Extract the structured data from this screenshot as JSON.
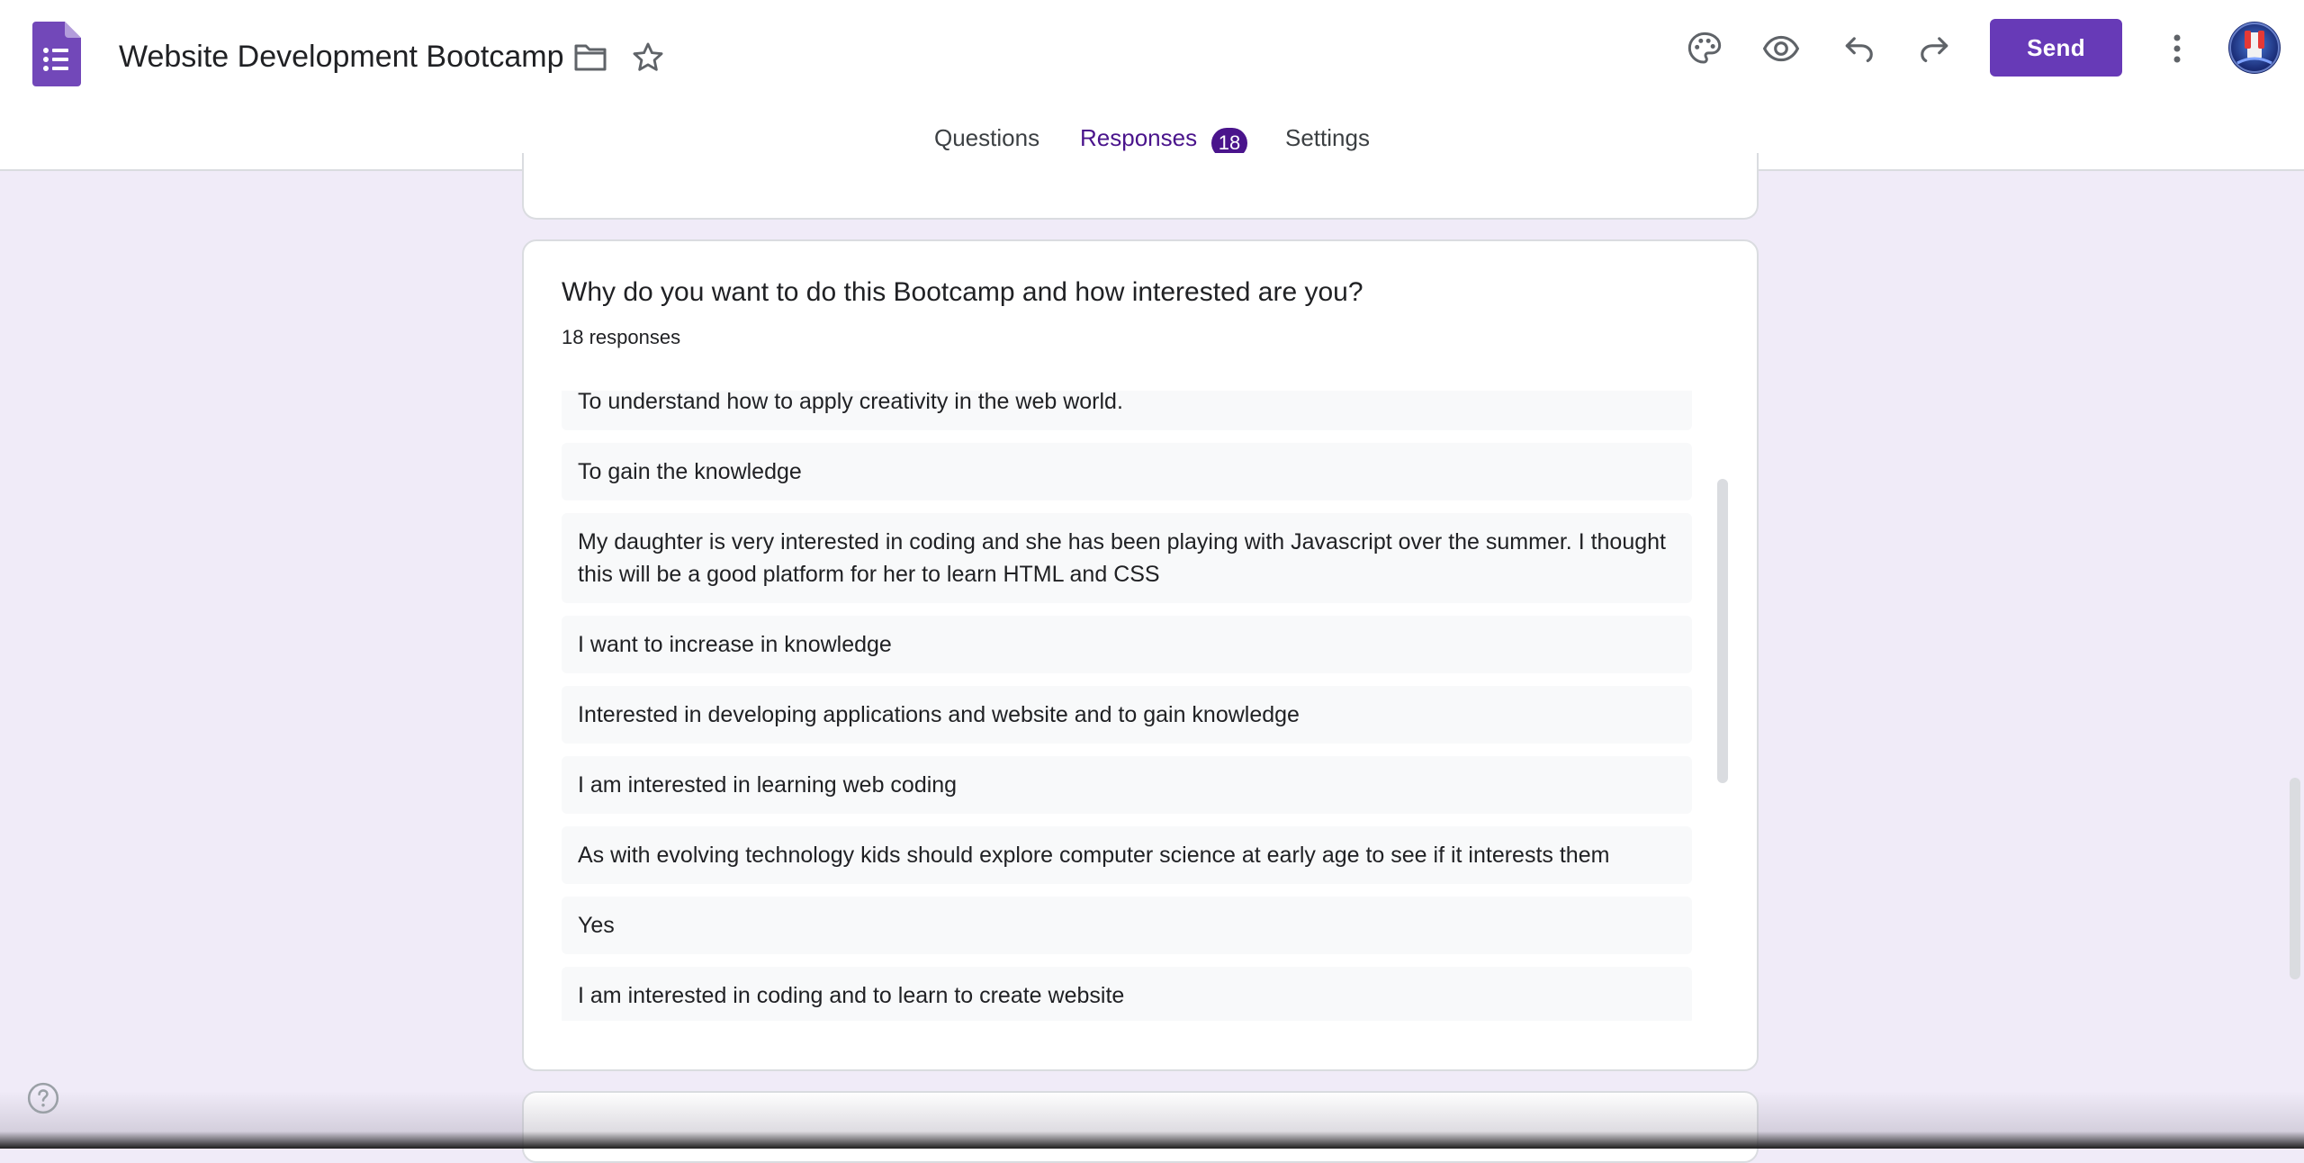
{
  "header": {
    "title": "Website Development Bootcamp",
    "send_label": "Send"
  },
  "tabs": {
    "questions": "Questions",
    "responses": "Responses",
    "responses_count": "18",
    "settings": "Settings"
  },
  "question": {
    "title": "Why do you want to do this Bootcamp and how interested are you?",
    "response_count": "18 responses",
    "responses": [
      "To understand how to apply creativity in the web world.",
      "To gain the knowledge",
      "My daughter is very interested in coding and she has been playing with Javascript over the summer. I thought this will be a good platform for her to learn HTML and CSS",
      "I want to increase in knowledge",
      "Interested in developing applications and website and to gain knowledge",
      "I am interested in learning web coding",
      "As with evolving technology kids should explore computer science at early age to see if it interests them",
      "Yes",
      "I am interested in coding and to learn to create website"
    ]
  },
  "colors": {
    "accent": "#673ab7",
    "tab_active": "#4a148c",
    "page_background": "#f0ebf8"
  },
  "icons": {
    "logo": "google-forms-icon",
    "folder": "folder-icon",
    "star": "star-icon",
    "palette": "palette-icon",
    "preview": "eye-icon",
    "undo": "undo-icon",
    "redo": "redo-icon",
    "more": "more-vert-icon",
    "help": "help-icon"
  }
}
